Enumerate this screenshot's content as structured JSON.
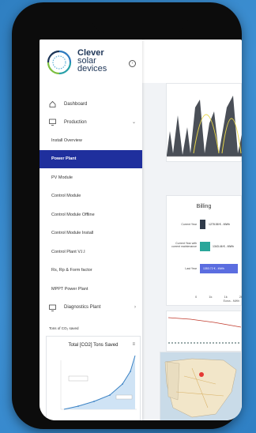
{
  "brand": {
    "line1": "Clever",
    "line2": "solar",
    "line3": "devices"
  },
  "nav": [
    {
      "label": "Dashboard"
    },
    {
      "label": "Production"
    },
    {
      "label": "Install Overview"
    },
    {
      "label": "Power Plant"
    },
    {
      "label": "PV Module"
    },
    {
      "label": "Control Module"
    },
    {
      "label": "Control Module Offline"
    },
    {
      "label": "Control Module Install"
    },
    {
      "label": "Control Plant V.I.I"
    },
    {
      "label": "Rs, Rp & Form factor"
    },
    {
      "label": "MPPT Power Plant"
    },
    {
      "label": "Diagnostics Plant"
    }
  ],
  "co2": {
    "section_label": "Tons of CO₂ saved",
    "chart_title": "Total [CO2] Tons Saved"
  },
  "billing": {
    "title": "Billing",
    "rows": [
      {
        "label": "Current Year",
        "value": "1278.58 € - MWh",
        "color": "#2f3a4a"
      },
      {
        "label": "Current Year with current maintenance",
        "value": "1343.46 € - MWh",
        "color": "#2aa69a"
      },
      {
        "label": "Last Year",
        "value": "1353.72 € - MWh",
        "color": "#5b6de0"
      }
    ],
    "ticks": [
      "0",
      "1k",
      "1k",
      "2k"
    ],
    "axis_caption": "Euros - MWh"
  },
  "colors": {
    "active_nav": "#1f2f9d",
    "background": "#2f7fc1",
    "brand": "#1d3557"
  }
}
